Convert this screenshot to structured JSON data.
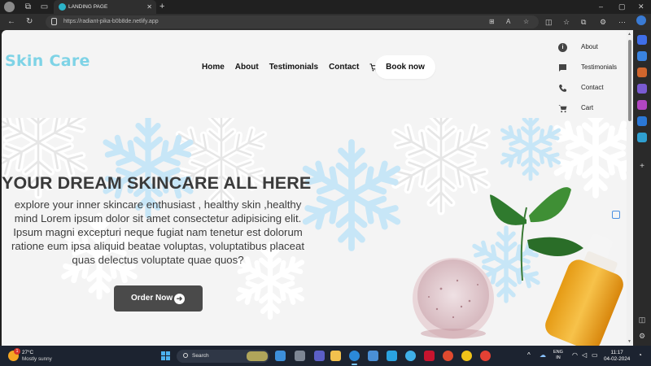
{
  "browser": {
    "tab_title": "LANDING PAGE",
    "tab_close": "✕",
    "new_tab": "+",
    "url": "https://radiant-pika-b0b8de.netlify.app",
    "window_controls": {
      "minimize": "–",
      "maximize": "▢",
      "close": "✕"
    }
  },
  "site": {
    "logo": "Skin Care",
    "nav": [
      "Home",
      "About",
      "Testimonials",
      "Contact"
    ],
    "book_button": "Book now",
    "side_menu": [
      {
        "label": "About",
        "icon": "info-icon"
      },
      {
        "label": "Testimonials",
        "icon": "chat-icon"
      },
      {
        "label": "Contact",
        "icon": "phone-icon"
      },
      {
        "label": "Cart",
        "icon": "cart-icon"
      }
    ],
    "hero": {
      "headline": "YOUR DREAM SKINCARE ALL HERE",
      "paragraph": "explore your inner skincare enthusiast , healthy skin ,healthy mind Lorem ipsum dolor sit amet consectetur adipisicing elit. Ipsum magni excepturi neque fugiat nam tenetur est dolorum ratione eum ipsa aliquid beatae voluptas, voluptatibus placeat quas delectus voluptate quae quos?",
      "order_button": "Order Now"
    }
  },
  "taskbar": {
    "weather_temp": "27°C",
    "weather_condition": "Mostly sunny",
    "weather_badge": "1",
    "search_placeholder": "Search",
    "lang_line1": "ENG",
    "lang_line2": "IN",
    "time": "11:17",
    "date": "04-02-2024",
    "chevron": "^"
  },
  "colors": {
    "logo": "#7ed3e6",
    "order_button": "#4a4a4a",
    "page_bg": "#f4f4f4",
    "taskbar": "#1c2330"
  }
}
